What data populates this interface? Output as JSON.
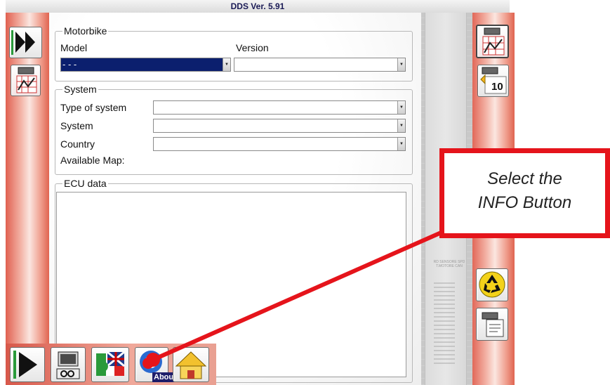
{
  "window": {
    "title": "DDS Ver.  5.91"
  },
  "motorbike": {
    "legend": "Motorbike",
    "model_label": "Model",
    "version_label": "Version",
    "model_value": "- - -",
    "version_value": ""
  },
  "system": {
    "legend": "System",
    "type_label": "Type of system",
    "system_label": "System",
    "country_label": "Country",
    "available_map_label": "Available Map:",
    "type_value": "",
    "system_value": "",
    "country_value": ""
  },
  "ecu": {
    "legend": "ECU data"
  },
  "right_toolbar": {
    "counter_badge": "10"
  },
  "bottom_toolbar": {
    "about_label": "About"
  },
  "deco": {
    "connector_text": "RD SENSORE SPD  T.MOTORE CAN"
  },
  "callout": {
    "line1": "Select the",
    "line2": "INFO Button"
  },
  "colors": {
    "accent_red": "#e5141b",
    "selection_blue": "#0b1f6e",
    "rail_salmon": "#e06050"
  }
}
